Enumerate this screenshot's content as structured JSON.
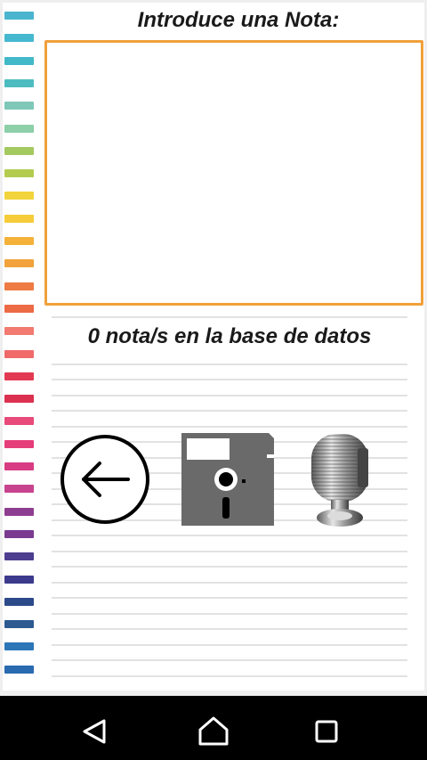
{
  "title": "Introduce una Nota:",
  "note_input": {
    "value": "",
    "placeholder": ""
  },
  "count_text": "0 nota/s en la base de datos",
  "actions": {
    "back": {
      "icon": "arrow-left-circle-icon"
    },
    "save": {
      "icon": "floppy-disk-icon"
    },
    "record": {
      "icon": "microphone-icon"
    }
  },
  "navigation": {
    "back": {
      "icon": "nav-back-icon"
    },
    "home": {
      "icon": "nav-home-icon"
    },
    "recents": {
      "icon": "nav-recents-icon"
    }
  },
  "colors": {
    "accent_border": "#f0a03a",
    "stripes": [
      "#4bb5cf",
      "#45b8d0",
      "#42b9c8",
      "#4cbcc0",
      "#7fc8b8",
      "#8ccfa8",
      "#a4c95f",
      "#b3cc4f",
      "#f2d43c",
      "#f6cc3a",
      "#f5b23a",
      "#f2a23a",
      "#ee7a44",
      "#ec6a44",
      "#f27a70",
      "#f06a6a",
      "#e23a52",
      "#dc3050",
      "#e84a7a",
      "#e53c7a",
      "#d83c82",
      "#c8438e",
      "#8e3e90",
      "#7a3a90",
      "#4e3e90",
      "#3c3a8c",
      "#2c4a8a",
      "#2c5a90",
      "#2c76b8",
      "#2a6ab0"
    ]
  }
}
